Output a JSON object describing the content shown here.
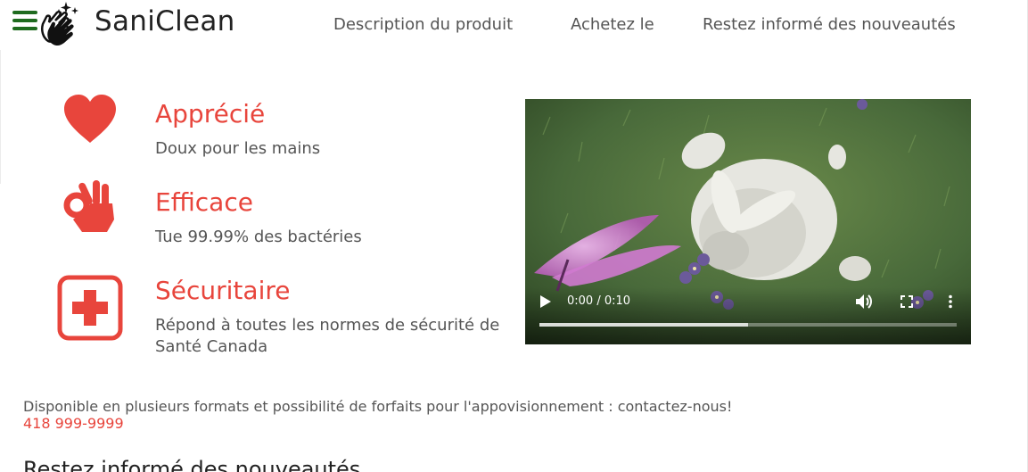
{
  "header": {
    "menu_icon": "hamburger-menu-icon",
    "logo_icon": "clapping-hands-sparkle-icon",
    "brand": "SaniClean",
    "nav": [
      {
        "label": "Description du produit"
      },
      {
        "label": "Achetez le"
      },
      {
        "label": "Restez informé des nouveautés"
      }
    ]
  },
  "features": [
    {
      "icon": "heart-icon",
      "title": "Apprécié",
      "description": "Doux pour les mains"
    },
    {
      "icon": "ok-hand-icon",
      "title": "Efficace",
      "description": "Tue 99.99% des bactéries"
    },
    {
      "icon": "first-aid-icon",
      "title": "Sécuritaire",
      "description": "Répond à toutes les normes de sécurité de Santé Canada"
    }
  ],
  "video": {
    "time_label": "0:00 / 0:10",
    "progress_fraction": 0.5,
    "play_icon": "play-icon",
    "volume_icon": "volume-icon",
    "fullscreen_icon": "fullscreen-icon",
    "more_icon": "more-options-icon"
  },
  "footer": {
    "availability": "Disponible en plusieurs formats et possibilité de forfaits pour l'appovisionnement : contactez-nous!",
    "phone": "418 999-9999"
  },
  "section_heading": "Restez informé des nouveautés",
  "colors": {
    "accent": "#e8453c",
    "menu": "#1f6b1f",
    "text": "#555555"
  }
}
